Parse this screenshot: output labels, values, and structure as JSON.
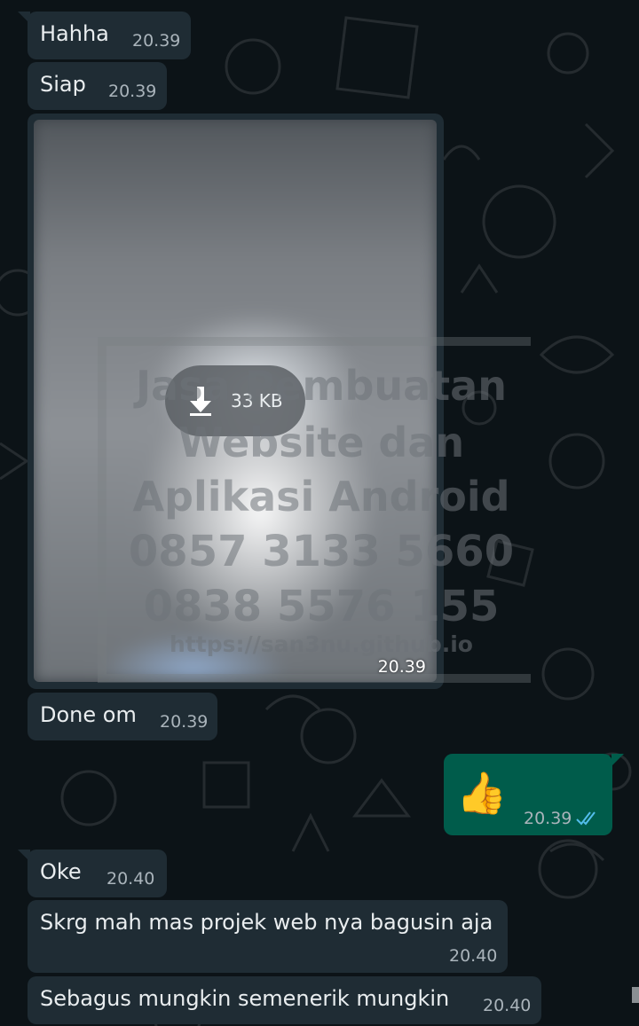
{
  "messages": [
    {
      "text": "Hahha",
      "time": "20.39",
      "direction": "incoming"
    },
    {
      "text": "Siap",
      "time": "20.39",
      "direction": "incoming"
    },
    {
      "type": "image",
      "download_size": "33 KB",
      "time": "20.39",
      "direction": "incoming"
    },
    {
      "text": "Done om",
      "time": "20.39",
      "direction": "incoming"
    },
    {
      "emoji": "👍",
      "time": "20.39",
      "direction": "outgoing",
      "status": "read"
    },
    {
      "text": "Oke",
      "time": "20.40",
      "direction": "incoming"
    },
    {
      "text": "Skrg mah mas projek web nya bagusin aja",
      "time": "20.40",
      "direction": "incoming"
    },
    {
      "text": "Sebagus mungkin semenerik mungkin",
      "time": "20.40",
      "direction": "incoming"
    }
  ],
  "watermark": {
    "lines": [
      "Jasa Pembuatan",
      "Website dan",
      "Aplikasi Android",
      "0857 3133 5660",
      "0838 5576 155",
      "https://san3nu.github.io"
    ]
  },
  "colors": {
    "background": "#0c1317",
    "incoming_bubble": "#1f2c34",
    "outgoing_bubble": "#005c4b",
    "read_ticks": "#53bdeb"
  },
  "icons": {
    "download": "download-arrow-icon",
    "read_receipt": "double-check-icon"
  }
}
